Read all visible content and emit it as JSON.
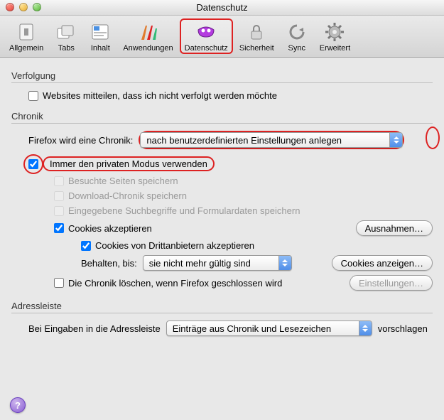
{
  "window": {
    "title": "Datenschutz"
  },
  "toolbar": {
    "items": [
      {
        "label": "Allgemein"
      },
      {
        "label": "Tabs"
      },
      {
        "label": "Inhalt"
      },
      {
        "label": "Anwendungen"
      },
      {
        "label": "Datenschutz"
      },
      {
        "label": "Sicherheit"
      },
      {
        "label": "Sync"
      },
      {
        "label": "Erweitert"
      }
    ],
    "selected": "Datenschutz"
  },
  "sections": {
    "tracking": {
      "title": "Verfolgung",
      "dnt_label": "Websites mitteilen, dass ich nicht verfolgt werden möchte",
      "dnt_checked": false
    },
    "history": {
      "title": "Chronik",
      "mode_label": "Firefox wird eine Chronik:",
      "mode_value": "nach benutzerdefinierten Einstellungen anlegen",
      "always_private_label": "Immer den privaten Modus verwenden",
      "always_private_checked": true,
      "remember_pages_label": "Besuchte Seiten speichern",
      "remember_downloads_label": "Download-Chronik speichern",
      "remember_forms_label": "Eingegebene Suchbegriffe und Formulardaten speichern",
      "accept_cookies_label": "Cookies akzeptieren",
      "accept_cookies_checked": true,
      "third_party_label": "Cookies von Drittanbietern akzeptieren",
      "third_party_checked": true,
      "keep_until_label": "Behalten, bis:",
      "keep_until_value": "sie nicht mehr gültig sind",
      "clear_on_close_label": "Die Chronik löschen, wenn Firefox geschlossen wird",
      "clear_on_close_checked": false,
      "btn_exceptions": "Ausnahmen…",
      "btn_show_cookies": "Cookies anzeigen…",
      "btn_settings": "Einstellungen…"
    },
    "addressbar": {
      "title": "Adressleiste",
      "label_pre": "Bei Eingaben in die Adressleiste",
      "value": "Einträge aus Chronik und Lesezeichen",
      "label_post": "vorschlagen"
    }
  },
  "help_glyph": "?"
}
